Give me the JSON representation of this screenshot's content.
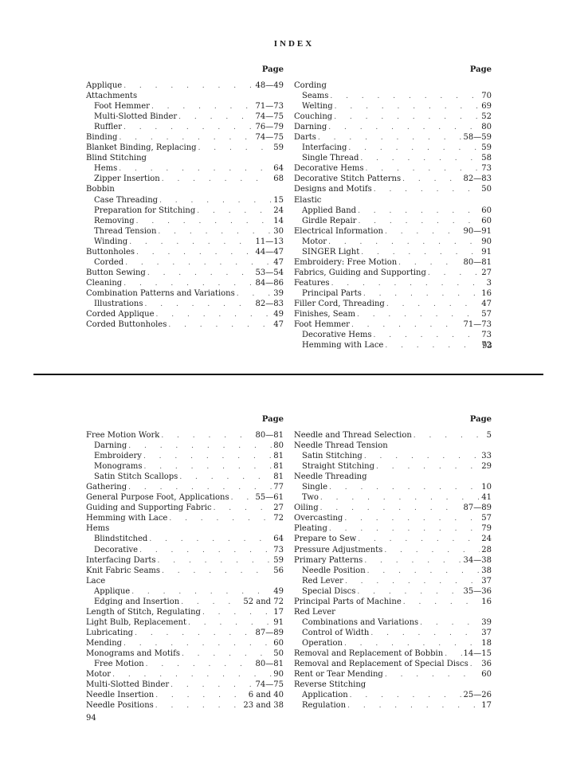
{
  "top_page": {
    "title": "INDEX",
    "left_column": {
      "header": "Page",
      "entries": [
        {
          "label": "Applique",
          "page": "48—49",
          "level": 0
        },
        {
          "label": "Attachments",
          "page": "",
          "level": 0
        },
        {
          "label": "Foot Hemmer",
          "page": "71—73",
          "level": 1
        },
        {
          "label": "Multi-Slotted Binder",
          "page": "74—75",
          "level": 1
        },
        {
          "label": "Ruffler",
          "page": "76—79",
          "level": 1
        },
        {
          "label": "Binding",
          "page": "74—75",
          "level": 0
        },
        {
          "label": "Blanket Binding, Replacing",
          "page": "59",
          "level": 0
        },
        {
          "label": "Blind Stitching",
          "page": "",
          "level": 0
        },
        {
          "label": "Hems",
          "page": "64",
          "level": 1
        },
        {
          "label": "Zipper Insertion",
          "page": "68",
          "level": 1
        },
        {
          "label": "Bobbin",
          "page": "",
          "level": 0
        },
        {
          "label": "Case Threading",
          "page": "15",
          "level": 1
        },
        {
          "label": "Preparation for Stitching",
          "page": "24",
          "level": 1
        },
        {
          "label": "Removing",
          "page": "14",
          "level": 1
        },
        {
          "label": "Thread Tension",
          "page": "30",
          "level": 1
        },
        {
          "label": "Winding",
          "page": "11—13",
          "level": 1
        },
        {
          "label": "Buttonholes",
          "page": "44—47",
          "level": 0
        },
        {
          "label": "Corded",
          "page": "47",
          "level": 1
        },
        {
          "label": "Button Sewing",
          "page": "53—54",
          "level": 0
        },
        {
          "label": "Cleaning",
          "page": "84—86",
          "level": 0
        },
        {
          "label": "Combination Patterns and Variations",
          "page": "39",
          "level": 0
        },
        {
          "label": "Illustrations",
          "page": "82—83",
          "level": 1
        },
        {
          "label": "Corded Applique",
          "page": "49",
          "level": 0
        },
        {
          "label": "Corded Buttonholes",
          "page": "47",
          "level": 0
        }
      ]
    },
    "right_column": {
      "header": "Page",
      "entries": [
        {
          "label": "Cording",
          "page": "",
          "level": 0
        },
        {
          "label": "Seams",
          "page": "70",
          "level": 1
        },
        {
          "label": "Welting",
          "page": "69",
          "level": 1
        },
        {
          "label": "Couching",
          "page": "52",
          "level": 0
        },
        {
          "label": "Darning",
          "page": "80",
          "level": 0
        },
        {
          "label": "Darts",
          "page": "58—59",
          "level": 0
        },
        {
          "label": "Interfacing",
          "page": "59",
          "level": 1
        },
        {
          "label": "Single Thread",
          "page": "58",
          "level": 1
        },
        {
          "label": "Decorative Hems",
          "page": "73",
          "level": 0
        },
        {
          "label": "Decorative Stitch Patterns",
          "page": "82—83",
          "level": 0
        },
        {
          "label": "Designs and Motifs",
          "page": "50",
          "level": 0
        },
        {
          "label": "Elastic",
          "page": "",
          "level": 0
        },
        {
          "label": "Applied Band",
          "page": "60",
          "level": 1
        },
        {
          "label": "Girdle Repair",
          "page": "60",
          "level": 1
        },
        {
          "label": "Electrical Information",
          "page": "90—91",
          "level": 0
        },
        {
          "label": "Motor",
          "page": "90",
          "level": 1
        },
        {
          "label": "SINGER Light",
          "page": "91",
          "level": 1
        },
        {
          "label": "Embroidery: Free Motion",
          "page": "80—81",
          "level": 0
        },
        {
          "label": "Fabrics, Guiding and Supporting",
          "page": "27",
          "level": 0
        },
        {
          "label": "Features",
          "page": "3",
          "level": 0
        },
        {
          "label": "Principal Parts",
          "page": "16",
          "level": 1
        },
        {
          "label": "Filler Cord, Threading",
          "page": "47",
          "level": 0
        },
        {
          "label": "Finishes, Seam",
          "page": "57",
          "level": 0
        },
        {
          "label": "Foot Hemmer",
          "page": "71—73",
          "level": 0
        },
        {
          "label": "Decorative Hems",
          "page": "73",
          "level": 1
        },
        {
          "label": "Hemming with Lace",
          "page": "72",
          "level": 1
        }
      ]
    },
    "page_number": "93"
  },
  "bottom_page": {
    "left_column": {
      "header": "Page",
      "entries": [
        {
          "label": "Free Motion Work",
          "page": "80—81",
          "level": 0
        },
        {
          "label": "Darning",
          "page": "80",
          "level": 1
        },
        {
          "label": "Embroidery",
          "page": "81",
          "level": 1
        },
        {
          "label": "Monograms",
          "page": "81",
          "level": 1
        },
        {
          "label": "Satin Stitch Scallops",
          "page": "81",
          "level": 1
        },
        {
          "label": "Gathering",
          "page": "77",
          "level": 0
        },
        {
          "label": "General Purpose Foot, Applications",
          "page": "55—61",
          "level": 0
        },
        {
          "label": "Guiding and Supporting Fabric",
          "page": "27",
          "level": 0
        },
        {
          "label": "Hemming with Lace",
          "page": "72",
          "level": 0
        },
        {
          "label": "Hems",
          "page": "",
          "level": 0
        },
        {
          "label": "Blindstitched",
          "page": "64",
          "level": 1
        },
        {
          "label": "Decorative",
          "page": "73",
          "level": 1
        },
        {
          "label": "Interfacing Darts",
          "page": "59",
          "level": 0
        },
        {
          "label": "Knit Fabric Seams",
          "page": "56",
          "level": 0
        },
        {
          "label": "Lace",
          "page": "",
          "level": 0
        },
        {
          "label": "Applique",
          "page": "49",
          "level": 1
        },
        {
          "label": "Edging and Insertion",
          "page": "52 and 72",
          "level": 1
        },
        {
          "label": "Length of Stitch, Regulating",
          "page": "17",
          "level": 0
        },
        {
          "label": "Light Bulb, Replacement",
          "page": "91",
          "level": 0
        },
        {
          "label": "Lubricating",
          "page": "87—89",
          "level": 0
        },
        {
          "label": "Mending",
          "page": "60",
          "level": 0
        },
        {
          "label": "Monograms and Motifs",
          "page": "50",
          "level": 0
        },
        {
          "label": "Free Motion",
          "page": "80—81",
          "level": 1
        },
        {
          "label": "Motor",
          "page": "90",
          "level": 0
        },
        {
          "label": "Multi-Slotted Binder",
          "page": "74—75",
          "level": 0
        },
        {
          "label": "Needle Insertion",
          "page": "6 and 40",
          "level": 0
        },
        {
          "label": "Needle Positions",
          "page": "23 and 38",
          "level": 0
        }
      ]
    },
    "right_column": {
      "header": "Page",
      "entries": [
        {
          "label": "Needle and Thread Selection",
          "page": "5",
          "level": 0
        },
        {
          "label": "Needle Thread Tension",
          "page": "",
          "level": 0
        },
        {
          "label": "Satin Stitching",
          "page": "33",
          "level": 1
        },
        {
          "label": "Straight Stitching",
          "page": "29",
          "level": 1
        },
        {
          "label": "Needle Threading",
          "page": "",
          "level": 0
        },
        {
          "label": "Single",
          "page": "10",
          "level": 1
        },
        {
          "label": "Two",
          "page": "41",
          "level": 1
        },
        {
          "label": "Oiling",
          "page": "87—89",
          "level": 0
        },
        {
          "label": "Overcasting",
          "page": "57",
          "level": 0
        },
        {
          "label": "Pleating",
          "page": "79",
          "level": 0
        },
        {
          "label": "Prepare to Sew",
          "page": "24",
          "level": 0
        },
        {
          "label": "Pressure Adjustments",
          "page": "28",
          "level": 0
        },
        {
          "label": "Primary Patterns",
          "page": "34—38",
          "level": 0
        },
        {
          "label": "Needle Position",
          "page": "38",
          "level": 1
        },
        {
          "label": "Red Lever",
          "page": "37",
          "level": 1
        },
        {
          "label": "Special Discs",
          "page": "35—36",
          "level": 1
        },
        {
          "label": "Principal Parts of Machine",
          "page": "16",
          "level": 0
        },
        {
          "label": "Red Lever",
          "page": "",
          "level": 0
        },
        {
          "label": "Combinations and Variations",
          "page": "39",
          "level": 1
        },
        {
          "label": "Control of Width",
          "page": "37",
          "level": 1
        },
        {
          "label": "Operation",
          "page": "18",
          "level": 1
        },
        {
          "label": "Removal and Replacement of Bobbin",
          "page": "14—15",
          "level": 0
        },
        {
          "label": "Removal and Replacement of Special Discs",
          "page": "36",
          "level": 0
        },
        {
          "label": "Rent or Tear Mending",
          "page": "60",
          "level": 0
        },
        {
          "label": "Reverse Stitching",
          "page": "",
          "level": 0
        },
        {
          "label": "Application",
          "page": "25—26",
          "level": 1
        },
        {
          "label": "Regulation",
          "page": "17",
          "level": 1
        }
      ]
    },
    "page_number": "94"
  }
}
